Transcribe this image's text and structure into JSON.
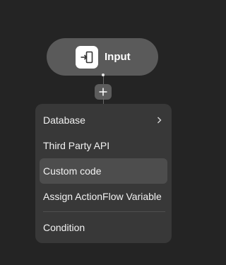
{
  "node": {
    "label": "Input",
    "icon": "sign-in-icon"
  },
  "add_button": {
    "icon": "plus-icon"
  },
  "menu": {
    "items": [
      {
        "label": "Database",
        "has_submenu": true
      },
      {
        "label": "Third Party API",
        "has_submenu": false
      },
      {
        "label": "Custom code",
        "has_submenu": false,
        "highlighted": true
      },
      {
        "label": "Assign ActionFlow Variable",
        "has_submenu": false
      },
      {
        "label": "Condition",
        "has_submenu": false
      }
    ]
  },
  "colors": {
    "canvas": "#242424",
    "node_background": "#5a5a5a",
    "menu_background": "#383838",
    "menu_highlight": "#4d4d4d",
    "text": "#f2f2f2"
  }
}
